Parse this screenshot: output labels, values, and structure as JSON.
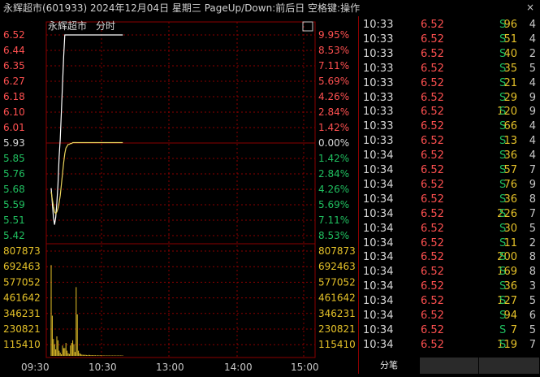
{
  "window": {
    "title": "永辉超市(601933) 2024年12月04日 星期三 PageUp/Down:前后日 空格键:操作",
    "close_label": "×"
  },
  "chart": {
    "name_label": "永辉超市",
    "mode_label": "分时",
    "toggle_label": "⎕"
  },
  "chart_data": {
    "type": "line",
    "price_axis": {
      "left_labels": [
        "6.52",
        "6.44",
        "6.35",
        "6.27",
        "6.18",
        "6.10",
        "6.01",
        "5.93",
        "5.85",
        "5.76",
        "5.68",
        "5.59",
        "5.51",
        "5.42"
      ],
      "right_labels": [
        "9.95%",
        "8.53%",
        "7.11%",
        "5.69%",
        "4.26%",
        "2.84%",
        "1.42%",
        "0.00%",
        "1.42%",
        "2.84%",
        "4.26%",
        "5.69%",
        "7.11%",
        "8.53%"
      ],
      "ylim": [
        5.42,
        6.52
      ],
      "prev_close": 5.93
    },
    "volume_axis": {
      "labels": [
        "807873",
        "692463",
        "577052",
        "461642",
        "346231",
        "230821",
        "115410"
      ],
      "ylim": [
        0,
        807873
      ]
    },
    "x_labels": [
      "09:30",
      "10:30",
      "13:00",
      "14:00",
      "15:00"
    ],
    "series": [
      {
        "values": [
          5.68,
          5.6,
          5.52,
          5.48,
          5.52,
          5.6,
          5.7,
          5.85,
          5.95,
          6.1,
          6.25,
          6.4,
          6.52,
          6.52,
          6.52,
          6.52,
          6.52,
          6.52,
          6.52,
          6.52,
          6.52,
          6.52,
          6.52,
          6.52,
          6.52,
          6.52,
          6.52,
          6.52,
          6.52,
          6.52,
          6.52,
          6.52,
          6.52,
          6.52,
          6.52,
          6.52,
          6.52,
          6.52,
          6.52,
          6.52,
          6.52,
          6.52,
          6.52,
          6.52,
          6.52,
          6.52,
          6.52,
          6.52,
          6.52,
          6.52,
          6.52,
          6.52,
          6.52,
          6.52,
          6.52,
          6.52,
          6.52,
          6.52,
          6.52,
          6.52,
          6.52,
          6.52,
          6.52,
          6.52
        ]
      },
      {
        "values": [
          5.66,
          5.62,
          5.58,
          5.55,
          5.54,
          5.55,
          5.57,
          5.6,
          5.64,
          5.7,
          5.76,
          5.82,
          5.87,
          5.9,
          5.91,
          5.92,
          5.92,
          5.925,
          5.925,
          5.93,
          5.93,
          5.93,
          5.93,
          5.93,
          5.93,
          5.93,
          5.93,
          5.93,
          5.93,
          5.93,
          5.93,
          5.93,
          5.93,
          5.93,
          5.93,
          5.93,
          5.93,
          5.93,
          5.93,
          5.93,
          5.93,
          5.93,
          5.93,
          5.93,
          5.93,
          5.93,
          5.93,
          5.93,
          5.93,
          5.93,
          5.93,
          5.93,
          5.93,
          5.93,
          5.93,
          5.93,
          5.93,
          5.93,
          5.93,
          5.93,
          5.93,
          5.93,
          5.93,
          5.93
        ]
      }
    ],
    "volumes": [
      700000,
      310000,
      130000,
      90000,
      50000,
      150000,
      120000,
      40000,
      25000,
      12000,
      80000,
      60000,
      60000,
      100000,
      40000,
      20000,
      15000,
      80000,
      100000,
      120000,
      90000,
      30000,
      530000,
      320000,
      40000,
      20000,
      15000,
      10000,
      9000,
      8000,
      9000,
      7000,
      6000,
      8000,
      7000,
      6000,
      5000,
      6000,
      5000,
      5000,
      4000,
      5000,
      4000,
      5000,
      4000,
      4000,
      3000,
      4000,
      3000,
      3000,
      4000,
      3000,
      3000,
      3000,
      3000,
      3000,
      3000,
      3000,
      3000,
      3000,
      3000,
      3000,
      3000,
      3000
    ],
    "colors": {
      "price_line": "#ffffff",
      "avg_line": "#e8d25a",
      "volume": "#e6c229",
      "up": "#ff5050",
      "down": "#20c060",
      "neutral": "#d8d8d8",
      "grid": "#8a0000"
    }
  },
  "ticks": [
    {
      "time": "10:33",
      "price": "6.52",
      "vol": "96",
      "side": "S",
      "count": "4"
    },
    {
      "time": "10:33",
      "price": "6.52",
      "vol": "51",
      "side": "S",
      "count": "4"
    },
    {
      "time": "10:33",
      "price": "6.52",
      "vol": "40",
      "side": "S",
      "count": "2"
    },
    {
      "time": "10:33",
      "price": "6.52",
      "vol": "35",
      "side": "S",
      "count": "5"
    },
    {
      "time": "10:33",
      "price": "6.52",
      "vol": "21",
      "side": "S",
      "count": "4"
    },
    {
      "time": "10:33",
      "price": "6.52",
      "vol": "29",
      "side": "S",
      "count": "9"
    },
    {
      "time": "10:33",
      "price": "6.52",
      "vol": "120",
      "side": "S",
      "count": "9"
    },
    {
      "time": "10:33",
      "price": "6.52",
      "vol": "66",
      "side": "S",
      "count": "4"
    },
    {
      "time": "10:33",
      "price": "6.52",
      "vol": "13",
      "side": "S",
      "count": "4"
    },
    {
      "time": "10:34",
      "price": "6.52",
      "vol": "36",
      "side": "S",
      "count": "4"
    },
    {
      "time": "10:34",
      "price": "6.52",
      "vol": "57",
      "side": "S",
      "count": "7"
    },
    {
      "time": "10:34",
      "price": "6.52",
      "vol": "76",
      "side": "S",
      "count": "9"
    },
    {
      "time": "10:34",
      "price": "6.52",
      "vol": "36",
      "side": "S",
      "count": "8"
    },
    {
      "time": "10:34",
      "price": "6.52",
      "vol": "226",
      "side": "S",
      "count": "7"
    },
    {
      "time": "10:34",
      "price": "6.52",
      "vol": "30",
      "side": "S",
      "count": "5"
    },
    {
      "time": "10:34",
      "price": "6.52",
      "vol": "11",
      "side": "S",
      "count": "2"
    },
    {
      "time": "10:34",
      "price": "6.52",
      "vol": "200",
      "side": "S",
      "count": "8"
    },
    {
      "time": "10:34",
      "price": "6.52",
      "vol": "169",
      "side": "S",
      "count": "8"
    },
    {
      "time": "10:34",
      "price": "6.52",
      "vol": "36",
      "side": "S",
      "count": "3"
    },
    {
      "time": "10:34",
      "price": "6.52",
      "vol": "127",
      "side": "S",
      "count": "5"
    },
    {
      "time": "10:34",
      "price": "6.52",
      "vol": "94",
      "side": "S",
      "count": "6"
    },
    {
      "time": "10:34",
      "price": "6.52",
      "vol": "7",
      "side": "S",
      "count": "5"
    },
    {
      "time": "10:34",
      "price": "6.52",
      "vol": "119",
      "side": "S",
      "count": "7"
    }
  ],
  "tabs": [
    {
      "label": "分笔",
      "active": true
    },
    {
      "label": "",
      "active": false
    },
    {
      "label": "",
      "active": false
    }
  ]
}
